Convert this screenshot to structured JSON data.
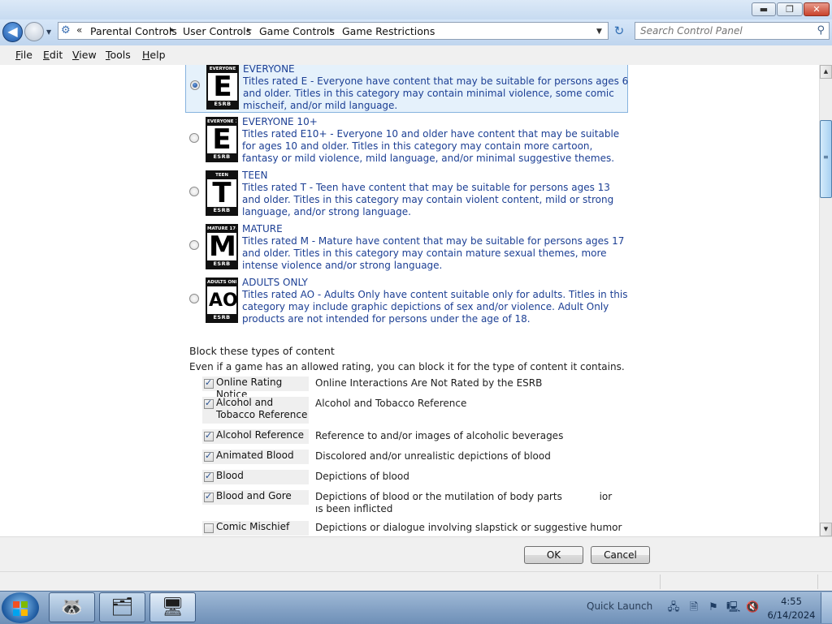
{
  "window": {
    "controls": {
      "minimize": "▬",
      "maximize": "❐",
      "close": "✕"
    }
  },
  "address": {
    "more_glyph": "«",
    "breadcrumbs": [
      "Parental Controls",
      "User Controls",
      "Game Controls",
      "Game Restrictions"
    ],
    "separator": "►",
    "dropdown_glyph": "▼",
    "refresh_glyph": "↻"
  },
  "search": {
    "placeholder": "Search Control Panel",
    "icon": "search-icon"
  },
  "menu": {
    "file": {
      "key": "F",
      "rest": "ile"
    },
    "edit": {
      "key": "E",
      "rest": "dit"
    },
    "view": {
      "key": "V",
      "rest": "iew"
    },
    "tools": {
      "key": "T",
      "rest": "ools"
    },
    "help": {
      "key": "H",
      "rest": "elp"
    }
  },
  "ratings": [
    {
      "title": "EVERYONE",
      "badge_top": "EVERYONE",
      "letter": "E",
      "badge_bottom": "ESRB",
      "selected": true,
      "description": "Titles rated E - Everyone have content that may be suitable for persons ages 6 and older. Titles in this category may contain minimal violence, some comic mischeif, and/or mild language."
    },
    {
      "title": "EVERYONE 10+",
      "badge_top": "EVERYONE 10+",
      "letter": "E",
      "badge_bottom": "ESRB",
      "selected": false,
      "description": "Titles rated E10+ - Everyone 10 and older have content that may be suitable for ages 10 and older. Titles in this category may contain more cartoon, fantasy or mild violence, mild language, and/or minimal suggestive themes."
    },
    {
      "title": "TEEN",
      "badge_top": "TEEN",
      "letter": "T",
      "badge_bottom": "ESRB",
      "selected": false,
      "description": "Titles rated T - Teen have content that may be suitable for persons ages 13 and older. Titles in this category may contain violent content, mild or strong language, and/or strong language."
    },
    {
      "title": "MATURE",
      "badge_top": "MATURE 17+",
      "letter": "M",
      "badge_bottom": "ESRB",
      "selected": false,
      "description": "Titles rated M - Mature have content that may be suitable for persons ages 17 and older. Titles in this category may contain mature sexual themes, more intense violence and/or strong language."
    },
    {
      "title": "ADULTS ONLY",
      "badge_top": "ADULTS ONLY 18+",
      "letter": "AO",
      "badge_bottom": "ESRB",
      "selected": false,
      "description": "Titles rated AO - Adults Only have content suitable only for adults.  Titles in this category may include graphic depictions of sex and/or violence.  Adult Only products are not intended for persons under the age of 18."
    }
  ],
  "block": {
    "heading": "Block these types of content",
    "intro": "Even if a game has an allowed rating, you can block it for the type of content it contains.",
    "items": [
      {
        "label": "Online Rating Notice",
        "description": "Online Interactions Are Not Rated by the ESRB",
        "checked": true
      },
      {
        "label": "Alcohol and Tobacco Reference",
        "description": "Alcohol and Tobacco Reference",
        "checked": true
      },
      {
        "label": "Alcohol Reference",
        "description": "Reference to and/or images of alcoholic beverages",
        "checked": true
      },
      {
        "label": "Animated Blood",
        "description": "Discolored and/or unrealistic depictions of blood",
        "checked": true
      },
      {
        "label": "Blood",
        "description": "Depictions of blood",
        "checked": true
      },
      {
        "label": "Blood and Gore",
        "description": "Depictions of blood or the mutilation of body parts            ior    ıs been inflicted",
        "checked": true
      },
      {
        "label": "Comic Mischief",
        "description": "Depictions or dialogue involving slapstick or suggestive humor",
        "checked": false
      }
    ]
  },
  "scrollbar": {
    "up": "▲",
    "down": "▼",
    "grip": "≡"
  },
  "buttons": {
    "ok": "OK",
    "cancel": "Cancel"
  },
  "taskbar": {
    "quick_launch": "Quick Launch",
    "time": "4:55",
    "date": "6/14/2024",
    "pinned": [
      {
        "name": "media-player-icon",
        "glyph": "🦝"
      },
      {
        "name": "explorer-folder-icon",
        "glyph": "🗂"
      },
      {
        "name": "control-panel-icon",
        "glyph": "🖥"
      }
    ],
    "tray": [
      {
        "name": "network-icon",
        "glyph": "🖧"
      },
      {
        "name": "device-icon",
        "glyph": "🗎"
      },
      {
        "name": "action-center-flag-icon",
        "glyph": "⚑"
      },
      {
        "name": "network-status-icon",
        "glyph": "🖳"
      },
      {
        "name": "volume-muted-icon",
        "glyph": "🔇"
      }
    ]
  }
}
